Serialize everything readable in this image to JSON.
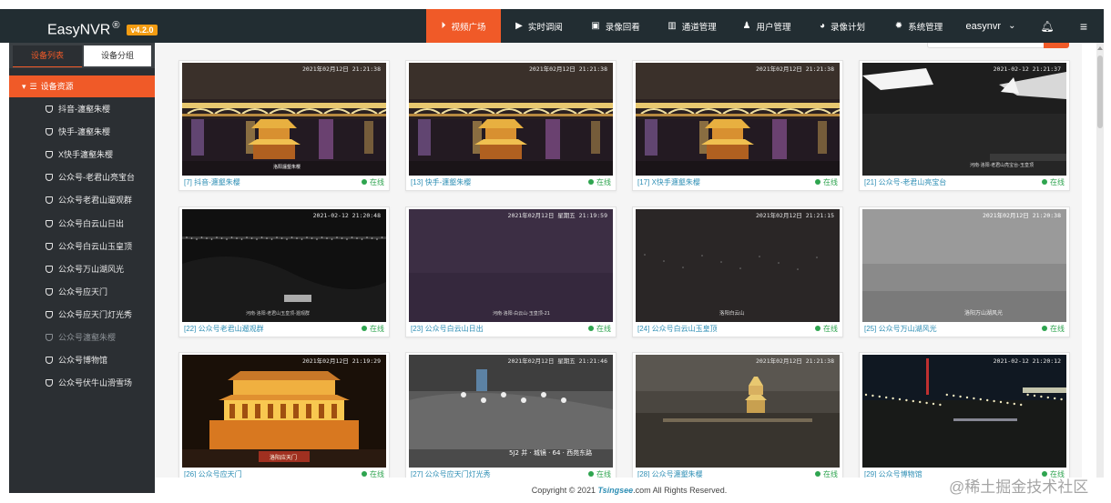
{
  "header": {
    "brand": "EasyNVR",
    "reg": "®",
    "version": "v4.2.0",
    "nav": [
      {
        "label": "视频广场",
        "icon": "play-circle-icon",
        "active": true
      },
      {
        "label": "实时调阅",
        "icon": "video-camera-icon",
        "active": false
      },
      {
        "label": "录像回看",
        "icon": "film-icon",
        "active": false
      },
      {
        "label": "通道管理",
        "icon": "columns-icon",
        "active": false
      },
      {
        "label": "用户管理",
        "icon": "user-icon",
        "active": false
      },
      {
        "label": "录像计划",
        "icon": "dashboard-icon",
        "active": false
      },
      {
        "label": "系统管理",
        "icon": "gear-icon",
        "active": false
      }
    ],
    "user": "easynvr",
    "icons": {
      "user_menu": "chevron-down-icon",
      "notify": "bell-icon",
      "menu": "hamburger-icon"
    }
  },
  "sidebar": {
    "tabs": [
      "设备列表",
      "设备分组"
    ],
    "root": "设备资源",
    "items": [
      {
        "label": "抖音-瀍壑朱樱",
        "dim": false
      },
      {
        "label": "快手-瀍壑朱樱",
        "dim": false
      },
      {
        "label": "X快手瀍壑朱樱",
        "dim": false
      },
      {
        "label": "公众号-老君山亮宝台",
        "dim": false
      },
      {
        "label": "公众号老君山遛观群",
        "dim": false
      },
      {
        "label": "公众号白云山日出",
        "dim": false
      },
      {
        "label": "公众号白云山玉皇顶",
        "dim": false
      },
      {
        "label": "公众号万山湖风光",
        "dim": false
      },
      {
        "label": "公众号应天门",
        "dim": false
      },
      {
        "label": "公众号应天门灯光秀",
        "dim": false
      },
      {
        "label": "公众号瀍壑朱樱",
        "dim": true
      },
      {
        "label": "公众号博物馆",
        "dim": false
      },
      {
        "label": "公众号伏牛山滑雪场",
        "dim": false
      }
    ]
  },
  "cards": [
    {
      "caption": "[7] 抖音-瀍壑朱樱",
      "status": "在线",
      "ts": "2021年02月12日 21:21:38",
      "scene": "bridge",
      "label": "洛阳瀍壑朱樱"
    },
    {
      "caption": "[13] 快手-瀍壑朱樱",
      "status": "在线",
      "ts": "2021年02月12日 21:21:38",
      "scene": "bridge",
      "label": ""
    },
    {
      "caption": "[17] X快手瀍壑朱樱",
      "status": "在线",
      "ts": "2021年02月12日 21:21:38",
      "scene": "bridge",
      "label": ""
    },
    {
      "caption": "[21] 公众号-老君山亮宝台",
      "status": "在线",
      "ts": "2021-02-12 21:21:37",
      "scene": "mountain",
      "label": "河南·洛阳·老君山亮宝台-玉皇顶"
    },
    {
      "caption": "[22] 公众号老君山遛观群",
      "status": "在线",
      "ts": "2021-02-12 21:20:48",
      "scene": "night",
      "label": "河南·洛阳·老君山玉皇顶-遛观群"
    },
    {
      "caption": "[23] 公众号白云山日出",
      "status": "在线",
      "ts": "2021年02月12日 星期五 21:19:59",
      "scene": "purple",
      "label": "河南·洛阳·白云山·玉皇顶-21"
    },
    {
      "caption": "[24] 公众号白云山玉皇顶",
      "status": "在线",
      "ts": "2021年02月12日 21:21:15",
      "scene": "darkfield",
      "label": "洛阳白云山"
    },
    {
      "caption": "[25] 公众号万山湖风光",
      "status": "在线",
      "ts": "2021年02月12日 21:20:38",
      "scene": "fog",
      "label": "洛阳万山湖风光"
    },
    {
      "caption": "[26] 公众号应天门",
      "status": "在线",
      "ts": "2021年02月12日 21:19:29",
      "scene": "gate",
      "label": "洛阳应天门"
    },
    {
      "caption": "[27] 公众号应天门灯光秀",
      "status": "在线",
      "ts": "2021年02月12日 星期五 21:21:46",
      "scene": "show",
      "label": "5J2 并 · 城镜 · 64 · 西苑东路"
    },
    {
      "caption": "[28] 公众号瀍壑朱樱",
      "status": "在线",
      "ts": "2021年02月12日 21:21:38",
      "scene": "pagoda",
      "label": ""
    },
    {
      "caption": "[29] 公众号博物馆",
      "status": "在线",
      "ts": "2021-02-12 21:20:12",
      "scene": "city",
      "label": ""
    }
  ],
  "footer": {
    "prefix": "Copyright © 2021 ",
    "brand": "Tsingsee",
    "suffix": ".com All Rights Reserved."
  },
  "watermark": "@稀土掘金技术社区",
  "colors": {
    "accent": "#f05a28",
    "topbar": "#222d32",
    "sidebar": "#2b2f33",
    "online": "#2ea44f",
    "caption": "#2f8fb5"
  }
}
